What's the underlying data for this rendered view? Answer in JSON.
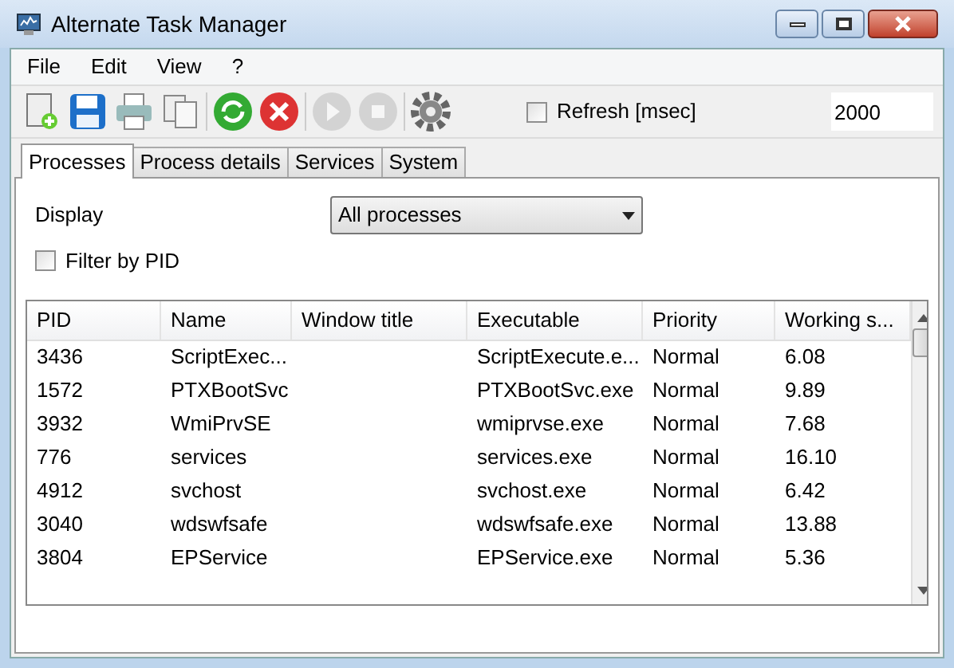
{
  "window": {
    "title": "Alternate Task Manager"
  },
  "menu": [
    "File",
    "Edit",
    "View",
    "?"
  ],
  "toolbar": {
    "refresh_checked": false,
    "refresh_label": "Refresh [msec]",
    "refresh_value": "2000"
  },
  "tabs": [
    {
      "label": "Processes",
      "selected": true
    },
    {
      "label": "Process details",
      "selected": false
    },
    {
      "label": "Services",
      "selected": false
    },
    {
      "label": "System",
      "selected": false
    }
  ],
  "display": {
    "label": "Display",
    "value": "All processes"
  },
  "filter": {
    "label": "Filter by PID",
    "checked": false
  },
  "table": {
    "columns": [
      "PID",
      "Name",
      "Window title",
      "Executable",
      "Priority",
      "Working s..."
    ],
    "rows": [
      [
        "3436",
        "ScriptExec...",
        "",
        "ScriptExecute.e...",
        "Normal",
        "6.08"
      ],
      [
        "1572",
        "PTXBootSvc",
        "",
        "PTXBootSvc.exe",
        "Normal",
        "9.89"
      ],
      [
        "3932",
        "WmiPrvSE",
        "",
        "wmiprvse.exe",
        "Normal",
        "7.68"
      ],
      [
        "776",
        "services",
        "",
        "services.exe",
        "Normal",
        "16.10"
      ],
      [
        "4912",
        "svchost",
        "",
        "svchost.exe",
        "Normal",
        "6.42"
      ],
      [
        "3040",
        "wdswfsafe",
        "",
        "wdswfsafe.exe",
        "Normal",
        "13.88"
      ],
      [
        "3804",
        "EPService",
        "",
        "EPService.exe",
        "Normal",
        "5.36"
      ]
    ]
  }
}
